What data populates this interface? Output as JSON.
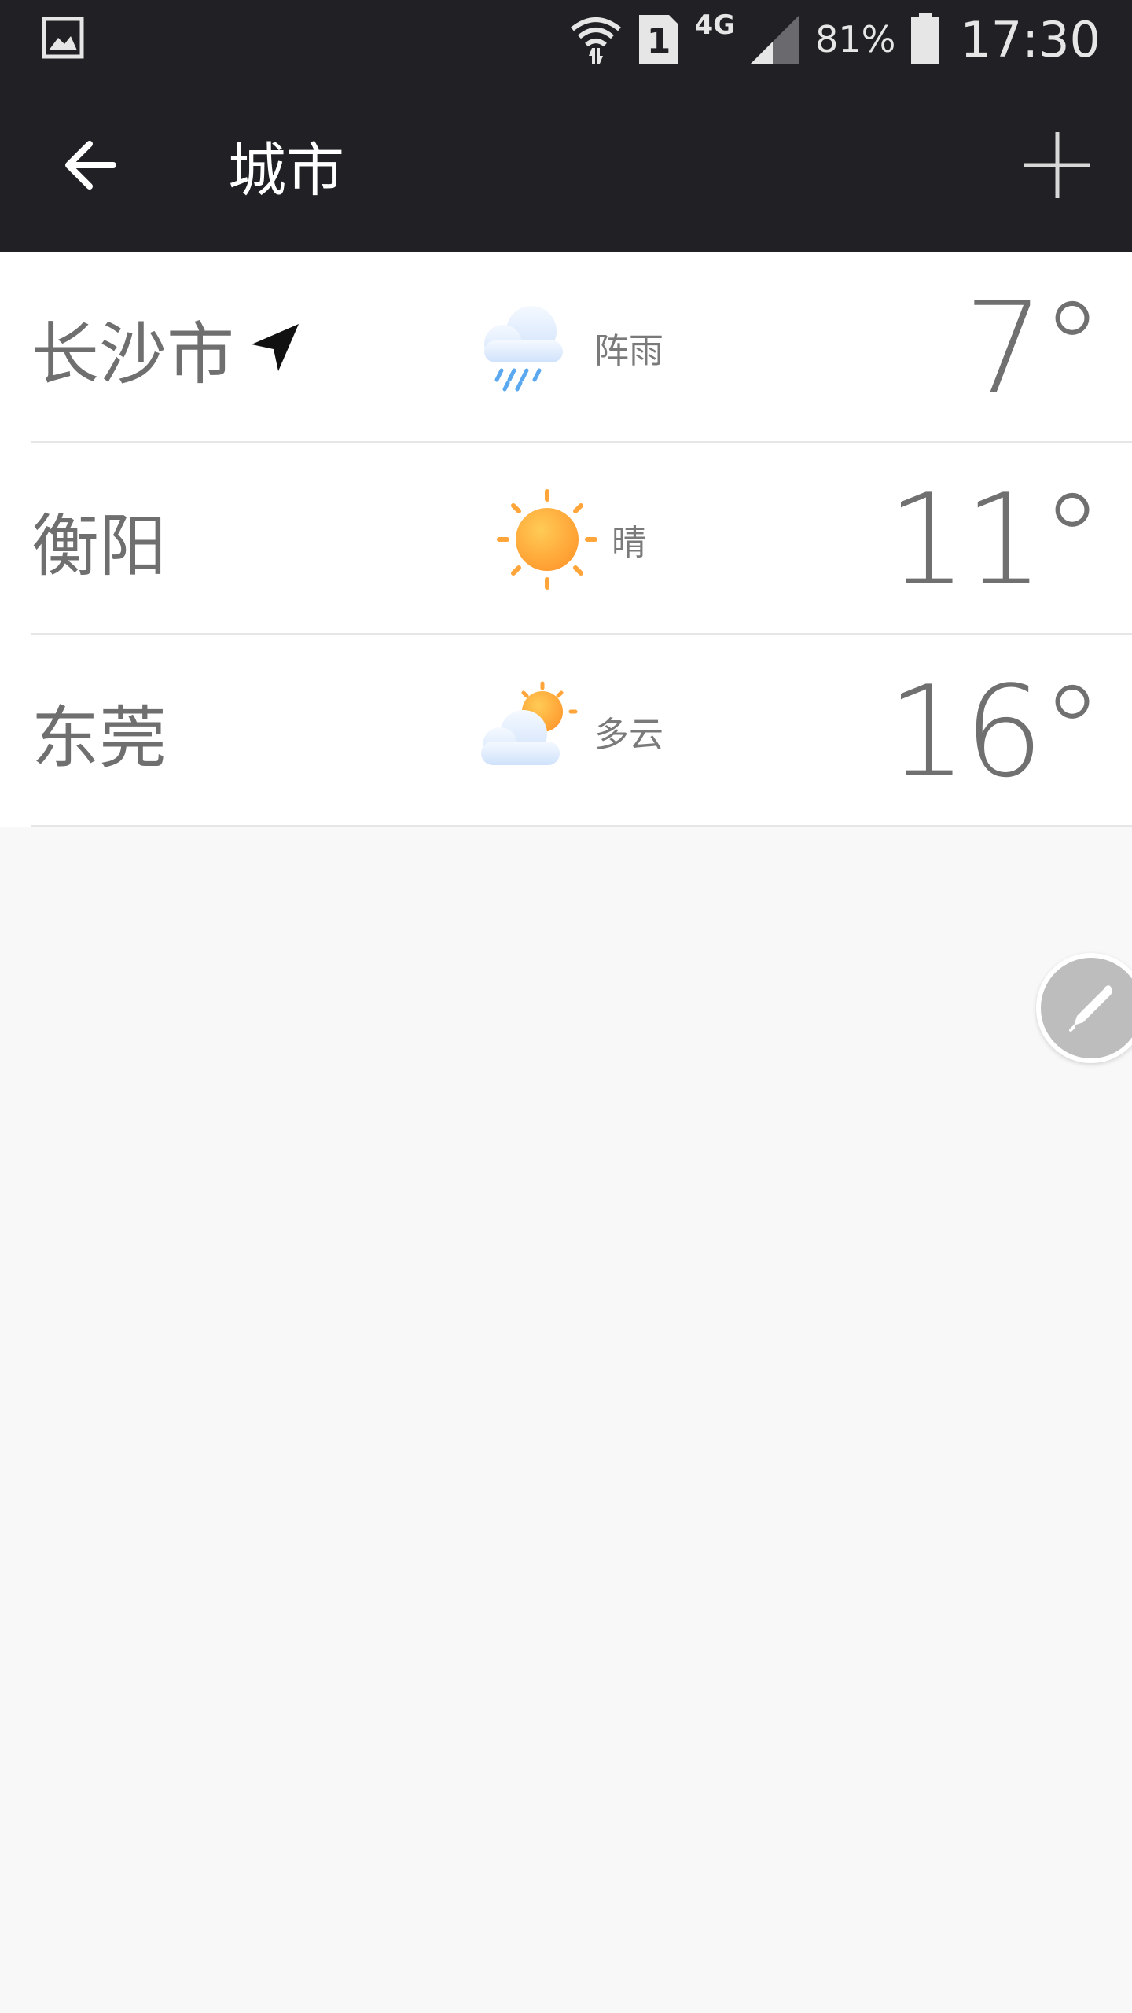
{
  "status_bar": {
    "battery_percent": "81%",
    "time": "17:30",
    "network": "4G",
    "sim_slot": "1",
    "left_icon": "image-icon"
  },
  "app_bar": {
    "title": "城市",
    "back_icon": "arrow-left-icon",
    "add_icon": "plus-icon"
  },
  "cities": [
    {
      "name": "长沙市",
      "located": true,
      "condition": "阵雨",
      "icon": "rain-cloud-icon",
      "temp": "7°"
    },
    {
      "name": "衡阳",
      "located": false,
      "condition": "晴",
      "icon": "sun-icon",
      "temp": "11°"
    },
    {
      "name": "东莞",
      "located": false,
      "condition": "多云",
      "icon": "partly-cloudy-icon",
      "temp": "16°"
    }
  ],
  "fab": {
    "icon": "pencil-icon"
  },
  "colors": {
    "bar_bg": "#202025",
    "list_bg": "#ffffff",
    "page_bg": "#f8f8f8",
    "text_gray": "#707070",
    "sun_orange": "#ffa53a",
    "rain_blue": "#5aa8f0",
    "fab_gray": "#bdbdbd"
  }
}
